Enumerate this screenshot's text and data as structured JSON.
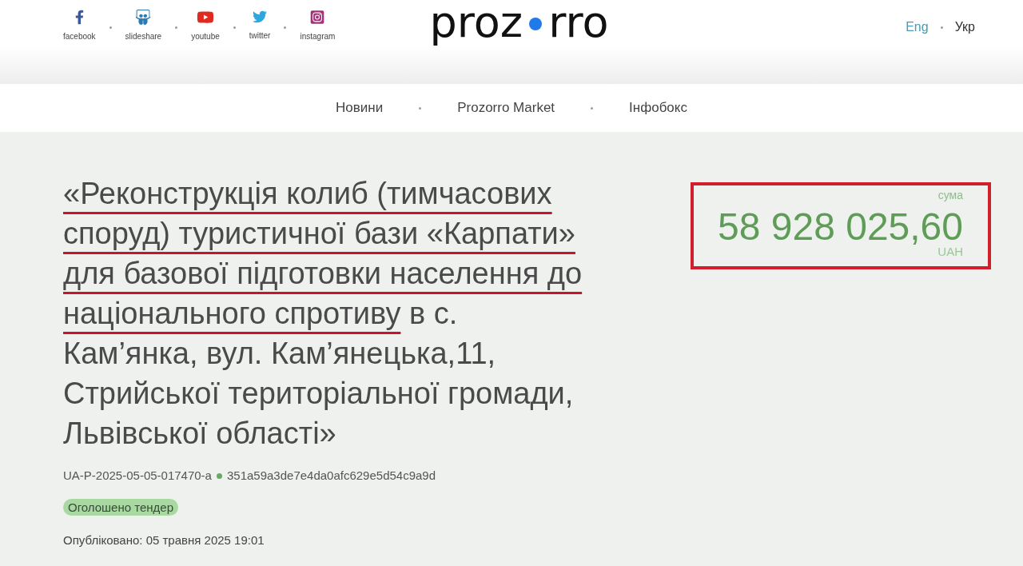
{
  "header": {
    "social_links": [
      {
        "label": "facebook",
        "kind": "facebook"
      },
      {
        "label": "slideshare",
        "kind": "slideshare"
      },
      {
        "label": "youtube",
        "kind": "youtube"
      },
      {
        "label": "twitter",
        "kind": "twitter"
      },
      {
        "label": "instagram",
        "kind": "instagram"
      }
    ],
    "logo": {
      "before_dot": "proz",
      "after_dot": "rro"
    },
    "languages": [
      {
        "label": "Eng",
        "selected": false
      },
      {
        "label": "Укр",
        "selected": true
      }
    ]
  },
  "nav": {
    "items": [
      {
        "label": "Новини"
      },
      {
        "label": "Prozorro Market"
      },
      {
        "label": "Інфобокс"
      }
    ]
  },
  "tender": {
    "title": [
      {
        "text": "«Реконструкція колиб (тимчасових споруд) туристичної бази «Карпати» для базової підготовки населення до національного спротиву",
        "underlined": true
      },
      {
        "text": "в с. Кам’янка, вул. Кам’янецька,11, Стрийської територіальної громади, Львівської області»",
        "underlined": false
      }
    ],
    "tender_id": "UA-P-2025-05-05-017470-a",
    "hash": "351a59a3de7e4da0afc629e5d54c9a9d",
    "status": "Оголошено тендер",
    "published": "Опубліковано: 05 травня 2025 19:01"
  },
  "amount": {
    "label": "сума",
    "value": "58 928 025,60",
    "currency": "UAH",
    "highlighted": true
  }
}
